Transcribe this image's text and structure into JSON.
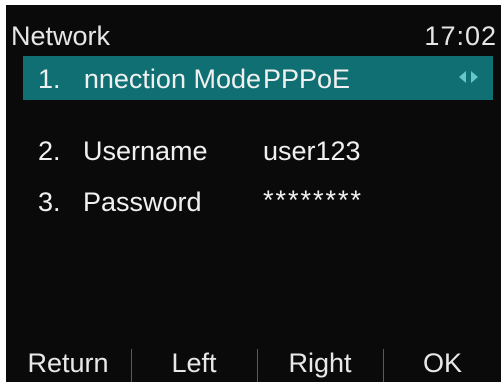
{
  "titlebar": {
    "title": "Network",
    "clock": "17:02"
  },
  "menu": {
    "items": [
      {
        "number": "1.",
        "label": "Connection Mode",
        "value": "PPPoE",
        "selected": true
      },
      {
        "number": "2.",
        "label": "Username",
        "value": "user123",
        "selected": false
      },
      {
        "number": "3.",
        "label": "Password",
        "value": "********",
        "selected": false
      }
    ]
  },
  "softkeys": {
    "return_label": "Return",
    "left_label": "Left",
    "right_label": "Right",
    "ok_label": "OK"
  },
  "colors": {
    "selection": "#0f6f72",
    "arrow": "#63c7cd",
    "screen_bg": "#0a0a0a",
    "text": "#f0f0f0"
  },
  "icons": {
    "selector": "left-right-arrows-icon"
  }
}
